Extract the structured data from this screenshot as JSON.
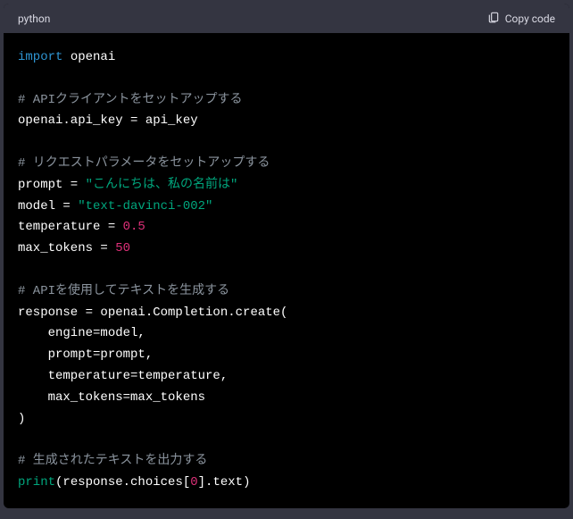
{
  "header": {
    "language": "python",
    "copy_label": "Copy code"
  },
  "code": {
    "kw_import": "import",
    "mod_openai": "openai",
    "comment_1": "# APIクライアントをセットアップする",
    "line_apikey": "openai.api_key = api_key",
    "comment_2": "# リクエストパラメータをセットアップする",
    "prompt_lhs": "prompt = ",
    "prompt_str": "\"こんにちは、私の名前は\"",
    "model_lhs": "model = ",
    "model_str": "\"text-davinci-002\"",
    "temp_lhs": "temperature = ",
    "temp_val": "0.5",
    "maxtok_lhs": "max_tokens = ",
    "maxtok_val": "50",
    "comment_3": "# APIを使用してテキストを生成する",
    "resp_line": "response = openai.Completion.create(",
    "arg_engine": "    engine=model,",
    "arg_prompt": "    prompt=prompt,",
    "arg_temp": "    temperature=temperature,",
    "arg_maxtok": "    max_tokens=max_tokens",
    "close_paren": ")",
    "comment_4": "# 生成されたテキストを出力する",
    "print_fn": "print",
    "print_open": "(response.choices[",
    "print_idx": "0",
    "print_close": "].text)"
  },
  "chart_data": {
    "type": "table",
    "title": "Python code snippet: OpenAI Completion API call",
    "lines": [
      "import openai",
      "",
      "# APIクライアントをセットアップする",
      "openai.api_key = api_key",
      "",
      "# リクエストパラメータをセットアップする",
      "prompt = \"こんにちは、私の名前は\"",
      "model = \"text-davinci-002\"",
      "temperature = 0.5",
      "max_tokens = 50",
      "",
      "# APIを使用してテキストを生成する",
      "response = openai.Completion.create(",
      "    engine=model,",
      "    prompt=prompt,",
      "    temperature=temperature,",
      "    max_tokens=max_tokens",
      ")",
      "",
      "# 生成されたテキストを出力する",
      "print(response.choices[0].text)"
    ]
  }
}
